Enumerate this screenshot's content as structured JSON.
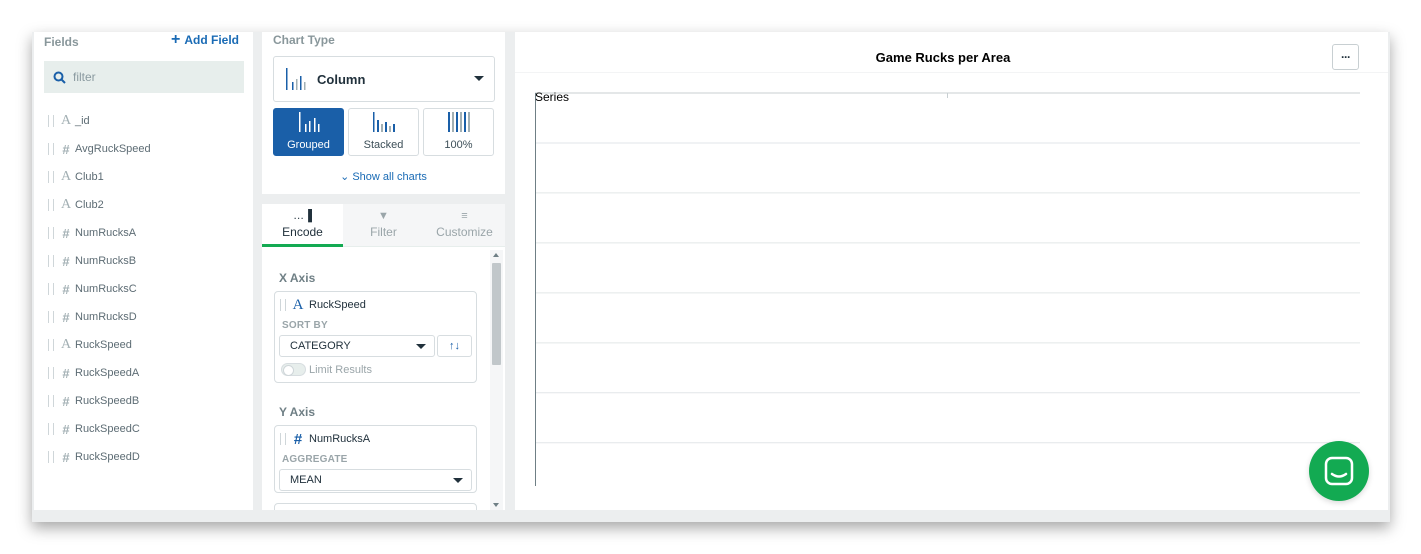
{
  "fields_panel": {
    "title": "Fields",
    "add_field_label": "Add Field",
    "search": {
      "placeholder": "filter"
    },
    "fields": [
      {
        "type": "string",
        "icon": "A",
        "name": "_id"
      },
      {
        "type": "number",
        "icon": "#",
        "name": "AvgRuckSpeed"
      },
      {
        "type": "string",
        "icon": "A",
        "name": "Club1"
      },
      {
        "type": "string",
        "icon": "A",
        "name": "Club2"
      },
      {
        "type": "number",
        "icon": "#",
        "name": "NumRucksA"
      },
      {
        "type": "number",
        "icon": "#",
        "name": "NumRucksB"
      },
      {
        "type": "number",
        "icon": "#",
        "name": "NumRucksC"
      },
      {
        "type": "number",
        "icon": "#",
        "name": "NumRucksD"
      },
      {
        "type": "string",
        "icon": "A",
        "name": "RuckSpeed"
      },
      {
        "type": "number",
        "icon": "#",
        "name": "RuckSpeedA"
      },
      {
        "type": "number",
        "icon": "#",
        "name": "RuckSpeedB"
      },
      {
        "type": "number",
        "icon": "#",
        "name": "RuckSpeedC"
      },
      {
        "type": "number",
        "icon": "#",
        "name": "RuckSpeedD"
      }
    ]
  },
  "chart_type": {
    "title": "Chart Type",
    "selected": "Column",
    "variants": [
      {
        "label": "Grouped",
        "active": true
      },
      {
        "label": "Stacked",
        "active": false
      },
      {
        "label": "100%",
        "active": false
      }
    ],
    "show_all_label": "Show all charts"
  },
  "encode_panel": {
    "tabs": [
      {
        "label": "Encode",
        "active": true
      },
      {
        "label": "Filter",
        "active": false
      },
      {
        "label": "Customize",
        "active": false
      }
    ],
    "x_axis": {
      "label": "X Axis",
      "field": "RuckSpeed",
      "sort_by_label": "SORT BY",
      "sort_value": "CATEGORY",
      "sort_icon": "↑↓",
      "limit_label": "Limit Results"
    },
    "y_axis": {
      "label": "Y Axis",
      "field": "NumRucksA",
      "aggregate_label": "AGGREGATE",
      "aggregate_value": "MEAN"
    }
  },
  "chart_panel": {
    "title": "Game Rucks per Area",
    "more_label": "···"
  },
  "chart_data": {
    "type": "bar",
    "title": "Game Rucks per Area",
    "legend_label": "Series",
    "series": [],
    "categories": [],
    "gridlines": 8,
    "grid": true
  },
  "colors": {
    "accent": "#1a5fa8",
    "link": "#1a6bb5",
    "active_tab": "#13aa52",
    "chat": "#13aa52"
  }
}
